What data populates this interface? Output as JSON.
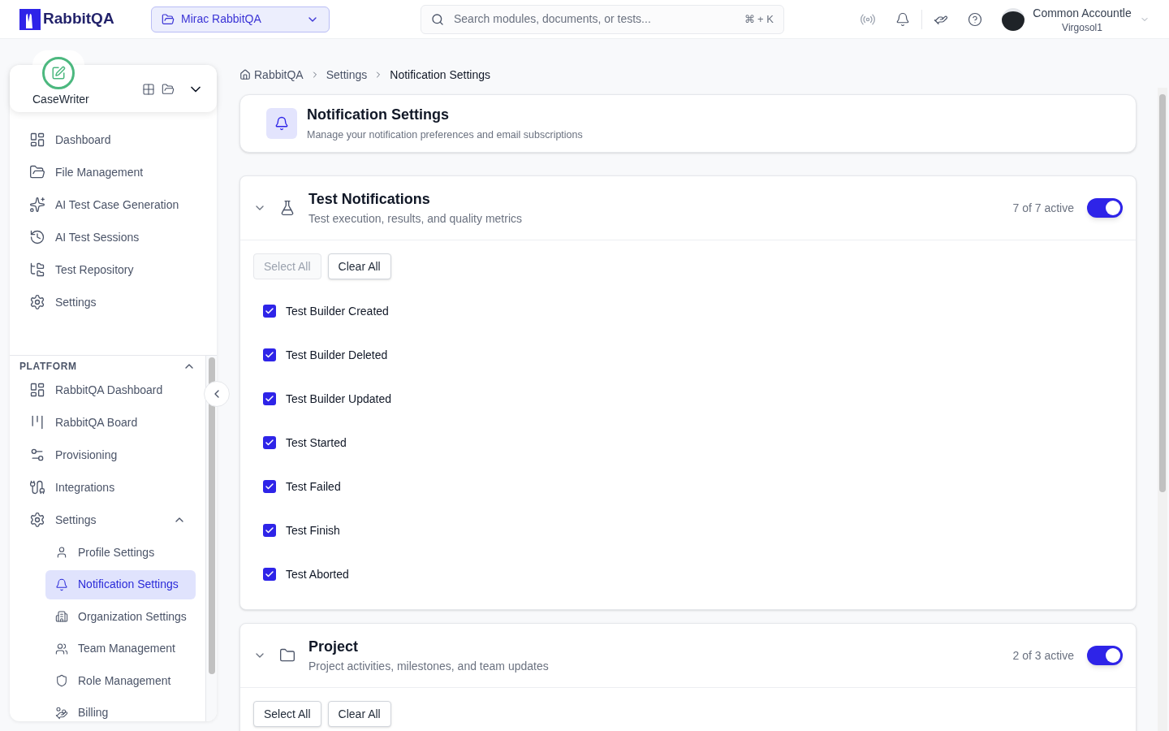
{
  "header": {
    "logo": "RabbitQA",
    "project": "Mirac RabbitQA",
    "search": {
      "placeholder": "Search modules, documents, or tests...",
      "shortcut": "⌘ + K"
    },
    "user": {
      "name": "Common Accountle",
      "org": "Virgosol1"
    }
  },
  "sidebar": {
    "app": "CaseWriter",
    "items": [
      {
        "label": "Dashboard",
        "selected": false
      },
      {
        "label": "File Management",
        "selected": false
      },
      {
        "label": "AI Test Case Generation",
        "selected": false
      },
      {
        "label": "AI Test Sessions",
        "selected": false
      },
      {
        "label": "Test Repository",
        "selected": false
      },
      {
        "label": "Settings",
        "selected": false
      }
    ],
    "platform": {
      "title": "PLATFORM",
      "expanded": true,
      "items": [
        {
          "label": "RabbitQA Dashboard",
          "selected": false
        },
        {
          "label": "RabbitQA Board",
          "selected": false
        },
        {
          "label": "Provisioning",
          "selected": false
        },
        {
          "label": "Integrations",
          "selected": false
        },
        {
          "label": "Settings",
          "selected": false,
          "expanded": true,
          "children": [
            {
              "label": "Profile Settings",
              "selected": false
            },
            {
              "label": "Notification Settings",
              "selected": true
            },
            {
              "label": "Organization Settings",
              "selected": false
            },
            {
              "label": "Team Management",
              "selected": false
            },
            {
              "label": "Role Management",
              "selected": false
            },
            {
              "label": "Billing",
              "selected": false
            }
          ]
        }
      ]
    }
  },
  "breadcrumb": [
    "RabbitQA",
    "Settings",
    "Notification Settings"
  ],
  "page": {
    "title": "Notification Settings",
    "subtitle": "Manage your notification preferences and email subscriptions"
  },
  "sections": [
    {
      "title": "Test Notifications",
      "subtitle": "Test execution, results, and quality metrics",
      "count": "7 of 7 active",
      "on": true,
      "expanded": true,
      "select_all": {
        "label": "Select All",
        "disabled": true
      },
      "clear_all": {
        "label": "Clear All",
        "disabled": false
      },
      "items": [
        {
          "label": "Test Builder Created",
          "checked": true
        },
        {
          "label": "Test Builder Deleted",
          "checked": true
        },
        {
          "label": "Test Builder Updated",
          "checked": true
        },
        {
          "label": "Test Started",
          "checked": true
        },
        {
          "label": "Test Failed",
          "checked": true
        },
        {
          "label": "Test Finish",
          "checked": true
        },
        {
          "label": "Test Aborted",
          "checked": true
        }
      ]
    },
    {
      "title": "Project",
      "subtitle": "Project activities, milestones, and team updates",
      "count": "2 of 3 active",
      "on": true,
      "expanded": true,
      "select_all": {
        "label": "Select All",
        "disabled": false
      },
      "clear_all": {
        "label": "Clear All",
        "disabled": false
      }
    }
  ]
}
